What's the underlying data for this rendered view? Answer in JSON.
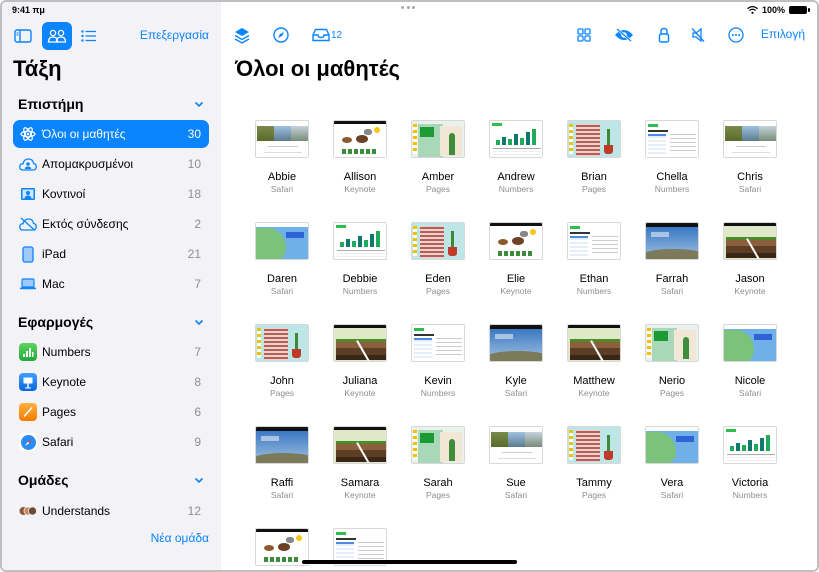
{
  "status_bar": {
    "time": "9:41 πμ",
    "battery": "100%"
  },
  "sidebar": {
    "edit_label": "Επεξεργασία",
    "title": "Τάξη",
    "science": {
      "header": "Επιστήμη",
      "items": [
        {
          "label": "Όλοι οι μαθητές",
          "count": "30",
          "icon": "atom-icon",
          "selected": true
        },
        {
          "label": "Απομακρυσμένοι",
          "count": "10",
          "icon": "remote-cloud-icon"
        },
        {
          "label": "Κοντινοί",
          "count": "18",
          "icon": "nearby-person-icon"
        },
        {
          "label": "Εκτός σύνδεσης",
          "count": "2",
          "icon": "offline-cloud-icon"
        },
        {
          "label": "iPad",
          "count": "21",
          "icon": "ipad-icon"
        },
        {
          "label": "Mac",
          "count": "7",
          "icon": "mac-laptop-icon"
        }
      ]
    },
    "apps": {
      "header": "Εφαρμογές",
      "items": [
        {
          "label": "Numbers",
          "count": "7",
          "icon": "numbers-app-icon"
        },
        {
          "label": "Keynote",
          "count": "8",
          "icon": "keynote-app-icon"
        },
        {
          "label": "Pages",
          "count": "6",
          "icon": "pages-app-icon"
        },
        {
          "label": "Safari",
          "count": "9",
          "icon": "safari-app-icon"
        }
      ]
    },
    "groups": {
      "header": "Ομάδες",
      "items": [
        {
          "label": "Understands",
          "count": "12",
          "icon": "group-avatars-icon"
        }
      ],
      "new_group_label": "Νέα ομάδα"
    }
  },
  "toolbar": {
    "inbox_count": "12",
    "select_label": "Επιλογή",
    "icons": [
      "layers-icon",
      "compass-icon",
      "inbox-tray-icon",
      "grid-icon",
      "hide-eye-icon",
      "lock-icon",
      "mute-icon",
      "more-icon"
    ]
  },
  "main": {
    "title": "Όλοι οι μαθητές",
    "students": [
      {
        "name": "Abbie",
        "app": "Safari",
        "thumb": "safari-forest"
      },
      {
        "name": "Allison",
        "app": "Keynote",
        "thumb": "keynote-animals"
      },
      {
        "name": "Amber",
        "app": "Pages",
        "thumb": "pages-green"
      },
      {
        "name": "Andrew",
        "app": "Numbers",
        "thumb": "numbers"
      },
      {
        "name": "Brian",
        "app": "Pages",
        "thumb": "pages-red"
      },
      {
        "name": "Chella",
        "app": "Numbers",
        "thumb": "numdoc"
      },
      {
        "name": "Chris",
        "app": "Safari",
        "thumb": "safari-forest"
      },
      {
        "name": "Daren",
        "app": "Safari",
        "thumb": "map"
      },
      {
        "name": "Debbie",
        "app": "Numbers",
        "thumb": "numbers"
      },
      {
        "name": "Eden",
        "app": "Pages",
        "thumb": "pages-red"
      },
      {
        "name": "Elie",
        "app": "Keynote",
        "thumb": "keynote-animals"
      },
      {
        "name": "Ethan",
        "app": "Numbers",
        "thumb": "numdoc"
      },
      {
        "name": "Farrah",
        "app": "Safari",
        "thumb": "energy"
      },
      {
        "name": "Jason",
        "app": "Keynote",
        "thumb": "keynote-soil"
      },
      {
        "name": "John",
        "app": "Pages",
        "thumb": "pages-red"
      },
      {
        "name": "Juliana",
        "app": "Keynote",
        "thumb": "keynote-soil"
      },
      {
        "name": "Kevin",
        "app": "Numbers",
        "thumb": "numdoc"
      },
      {
        "name": "Kyle",
        "app": "Safari",
        "thumb": "energy"
      },
      {
        "name": "Matthew",
        "app": "Keynote",
        "thumb": "keynote-soil"
      },
      {
        "name": "Nerio",
        "app": "Pages",
        "thumb": "pages-green"
      },
      {
        "name": "Nicole",
        "app": "Safari",
        "thumb": "map"
      },
      {
        "name": "Raffi",
        "app": "Safari",
        "thumb": "energy"
      },
      {
        "name": "Samara",
        "app": "Keynote",
        "thumb": "keynote-soil"
      },
      {
        "name": "Sarah",
        "app": "Pages",
        "thumb": "pages-green"
      },
      {
        "name": "Sue",
        "app": "Safari",
        "thumb": "safari-forest"
      },
      {
        "name": "Tammy",
        "app": "Pages",
        "thumb": "pages-red"
      },
      {
        "name": "Vera",
        "app": "Safari",
        "thumb": "map"
      },
      {
        "name": "Victoria",
        "app": "Numbers",
        "thumb": "numbers"
      },
      {
        "name": "",
        "app": "",
        "thumb": "keynote-animals"
      },
      {
        "name": "",
        "app": "",
        "thumb": "numdoc"
      }
    ]
  },
  "colors": {
    "accent": "#0a84ff",
    "sidebar_bg": "#f2f2f7",
    "secondary_text": "#8e8e93"
  }
}
